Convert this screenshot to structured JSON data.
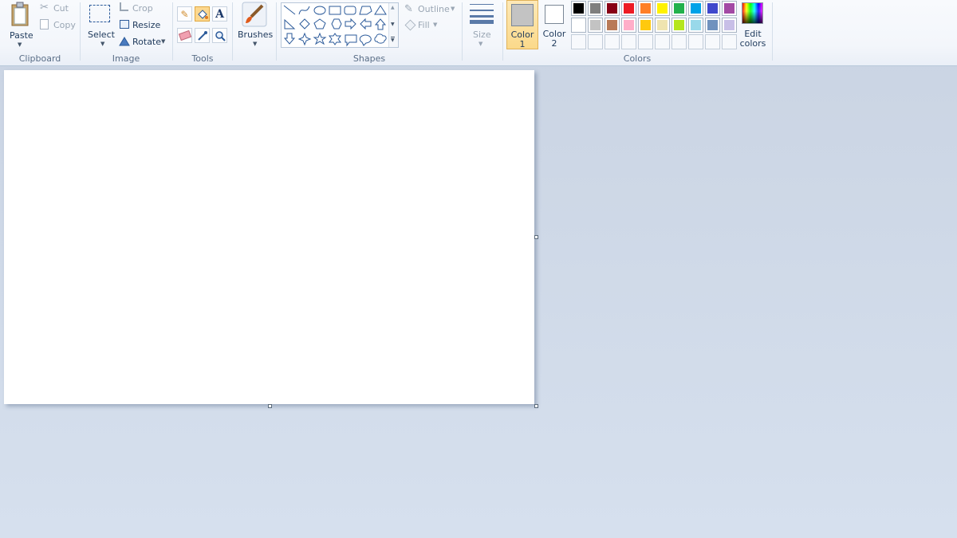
{
  "clipboard": {
    "paste": "Paste",
    "cut": "Cut",
    "copy": "Copy",
    "group": "Clipboard"
  },
  "image": {
    "select": "Select",
    "crop": "Crop",
    "resize": "Resize",
    "rotate": "Rotate",
    "group": "Image"
  },
  "tools": {
    "group": "Tools",
    "items": [
      "pencil-icon",
      "fill-bucket-icon",
      "text-icon",
      "eraser-icon",
      "color-picker-icon",
      "magnifier-icon"
    ],
    "active": "fill-bucket-icon"
  },
  "brushes": {
    "label": "Brushes"
  },
  "shapes": {
    "group": "Shapes",
    "outline": "Outline",
    "fill": "Fill",
    "items": [
      "line",
      "curve",
      "oval",
      "rectangle",
      "rounded-rectangle",
      "polygon",
      "triangle",
      "right-triangle",
      "diamond",
      "pentagon",
      "hexagon",
      "right-arrow",
      "left-arrow",
      "up-arrow",
      "down-arrow",
      "four-point-star",
      "five-point-star",
      "six-point-star",
      "rounded-callout",
      "oval-callout",
      "cloud-callout"
    ]
  },
  "size": {
    "label": "Size"
  },
  "color1": {
    "line1": "Color",
    "line2": "1",
    "value": "#c3c3c3"
  },
  "color2": {
    "line1": "Color",
    "line2": "2",
    "value": "#ffffff"
  },
  "colors": {
    "group": "Colors",
    "row1": [
      "#000000",
      "#7f7f7f",
      "#880015",
      "#ed1c24",
      "#ff7f27",
      "#fff200",
      "#22b14c",
      "#00a2e8",
      "#3f48cc",
      "#a349a4"
    ],
    "row2": [
      "#ffffff",
      "#c3c3c3",
      "#b97a57",
      "#ffaec9",
      "#ffc90e",
      "#efe4b0",
      "#b5e61d",
      "#99d9ea",
      "#7092be",
      "#c8bfe7"
    ],
    "row3_empty_count": 10
  },
  "edit_colors": {
    "line1": "Edit",
    "line2": "colors"
  }
}
